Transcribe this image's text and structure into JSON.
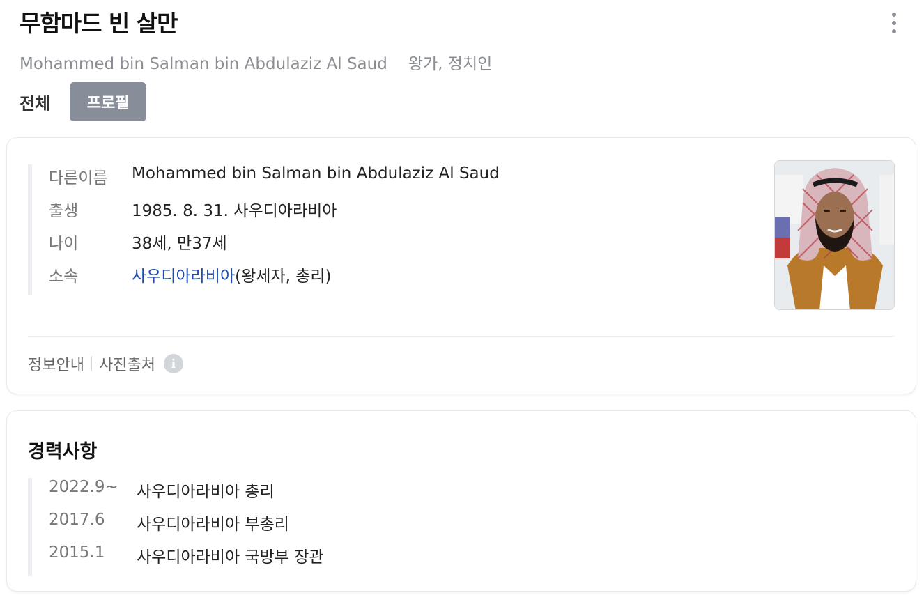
{
  "header": {
    "title": "무함마드 빈 살만",
    "english_name": "Mohammed bin Salman bin Abdulaziz Al Saud",
    "occupation": "왕가, 정치인"
  },
  "tabs": [
    {
      "label": "전체",
      "active": false
    },
    {
      "label": "프로필",
      "active": true
    }
  ],
  "profile": {
    "rows": [
      {
        "key": "다른이름",
        "value": "Mohammed bin Salman bin Abdulaziz Al Saud"
      },
      {
        "key": "출생",
        "value": "1985. 8. 31. 사우디아라비아"
      },
      {
        "key": "나이",
        "value": "38세, 만37세"
      },
      {
        "key": "소속",
        "link": "사우디아라비아",
        "value": "(왕세자, 총리)"
      }
    ],
    "footer": {
      "info_guide": "정보안내",
      "photo_source": "사진출처",
      "info_icon": "i"
    }
  },
  "career": {
    "title": "경력사항",
    "items": [
      {
        "date": "2022.9~",
        "text": "사우디아라비아 총리"
      },
      {
        "date": "2017.6",
        "text": "사우디아라비아 부총리"
      },
      {
        "date": "2015.1",
        "text": "사우디아라비아 국방부 장관"
      }
    ]
  },
  "colors": {
    "accent_link": "#1f4cb0",
    "active_tab": "#878d99"
  }
}
